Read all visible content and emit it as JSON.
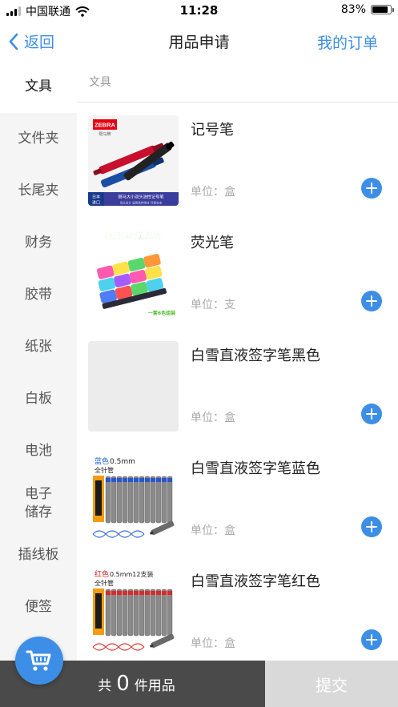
{
  "status_bar": {
    "carrier": "中国联通",
    "time": "11:28",
    "battery": "83%"
  },
  "nav": {
    "back_label": "返回",
    "title": "用品申请",
    "orders_label": "我的订单"
  },
  "sidebar": {
    "items": [
      {
        "label": "文具",
        "active": true
      },
      {
        "label": "文件夹"
      },
      {
        "label": "长尾夹"
      },
      {
        "label": "财务"
      },
      {
        "label": "胶带"
      },
      {
        "label": "纸张"
      },
      {
        "label": "白板"
      },
      {
        "label": "电池"
      },
      {
        "label": "电子\n储存"
      },
      {
        "label": "插线板"
      },
      {
        "label": "便签"
      }
    ]
  },
  "content": {
    "section_title": "文具",
    "products": [
      {
        "name": "记号笔",
        "unit": "单位：盒",
        "image": {
          "brand": "ZEBRA",
          "brand_sub": "斑马牌",
          "corner": "日本\n进口",
          "banner": "斑马大小双头油性记号笔",
          "tagline": "双头设计  适用各种场合  环保安全"
        }
      },
      {
        "name": "荧光笔",
        "unit": "单位：支",
        "image": {
          "headline": "经典斜塔荧光笔",
          "caption": "一套6色组装"
        }
      },
      {
        "name": "白雪直液签字笔黑色",
        "unit": "单位：盒",
        "image": {}
      },
      {
        "name": "白雪直液签字笔蓝色",
        "unit": "单位：盒",
        "image": {
          "color_word": "蓝色",
          "spec": "0.5mm",
          "type": "全针管"
        }
      },
      {
        "name": "白雪直液签字笔红色",
        "unit": "单位：盒",
        "image": {
          "color_word": "红色",
          "spec": "0.5mm12支装",
          "type": "全针管"
        }
      }
    ]
  },
  "footer": {
    "prefix": "共",
    "count": "0",
    "suffix": "件用品",
    "submit_label": "提交"
  },
  "colors": {
    "accent": "#3d8ee6",
    "footer_dark": "#4a4a4a",
    "submit_disabled": "#d9d9d9",
    "sidebar_bg": "#f5f5f5"
  },
  "icons": {
    "back": "chevron-left-icon",
    "add": "plus-circle-icon",
    "cart": "shopping-cart-icon",
    "wifi": "wifi-icon",
    "battery": "battery-icon",
    "signal": "signal-icon"
  }
}
